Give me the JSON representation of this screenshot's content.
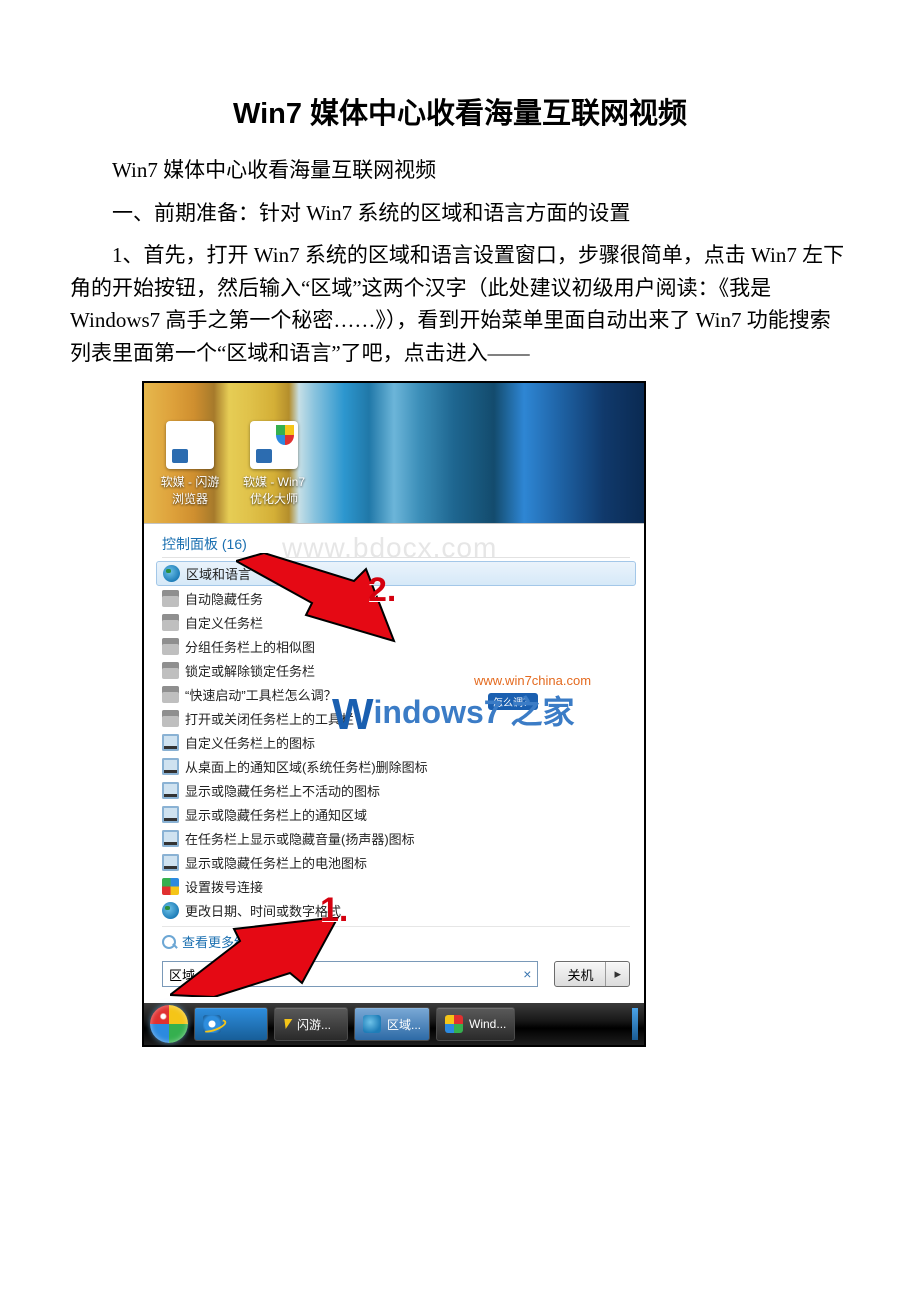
{
  "doc": {
    "title": "Win7 媒体中心收看海量互联网视频",
    "p1": "Win7 媒体中心收看海量互联网视频",
    "p2": "一、前期准备：针对 Win7 系统的区域和语言方面的设置",
    "p3": "1、首先，打开 Win7 系统的区域和语言设置窗口，步骤很简单，点击 Win7 左下角的开始按钮，然后输入“区域”这两个汉字（此处建议初级用户阅读：《我是 Windows7 高手之第一个秘密……》），看到开始菜单里面自动出来了 Win7 功能搜索列表里面第一个“区域和语言”了吧，点击进入——"
  },
  "screenshot": {
    "desktopIcons": [
      {
        "label": "软媒 - 闪游\n浏览器"
      },
      {
        "label": "软媒 - Win7\n优化大师"
      }
    ],
    "watermark_bg": "www.bdocx.com",
    "cpHeader": "控制面板 (16)",
    "results": [
      {
        "icon": "globe",
        "label": "区域和语言",
        "selected": true
      },
      {
        "icon": "task",
        "label": "自动隐藏任务"
      },
      {
        "icon": "task",
        "label": "自定义任务栏"
      },
      {
        "icon": "task",
        "label": "分组任务栏上的相似图"
      },
      {
        "icon": "task",
        "label": "锁定或解除锁定任务栏"
      },
      {
        "icon": "task",
        "label": "“快速启动”工具栏怎么调？"
      },
      {
        "icon": "task",
        "label": "打开或关闭任务栏上的工具栏"
      },
      {
        "icon": "mon",
        "label": "自定义任务栏上的图标"
      },
      {
        "icon": "mon",
        "label": "从桌面上的通知区域(系统任务栏)删除图标"
      },
      {
        "icon": "mon",
        "label": "显示或隐藏任务栏上不活动的图标"
      },
      {
        "icon": "mon",
        "label": "显示或隐藏任务栏上的通知区域"
      },
      {
        "icon": "mon",
        "label": "在任务栏上显示或隐藏音量(扬声器)图标"
      },
      {
        "icon": "mon",
        "label": "显示或隐藏任务栏上的电池图标"
      },
      {
        "icon": "net",
        "label": "设置拨号连接"
      },
      {
        "icon": "globe",
        "label": "更改日期、时间或数字格式"
      }
    ],
    "seeMore": "查看更多结果",
    "searchValue": "区域",
    "shutdown": "关机",
    "arrow1": "1.",
    "arrow2": "2.",
    "w7_url": "www.win7china.com",
    "w7_text": "indows7",
    "w7_cn": " 之家",
    "bubble": "怎么调？",
    "taskbar": [
      {
        "label": "闪游..."
      },
      {
        "label": "区域..."
      },
      {
        "label": "Wind..."
      }
    ]
  }
}
